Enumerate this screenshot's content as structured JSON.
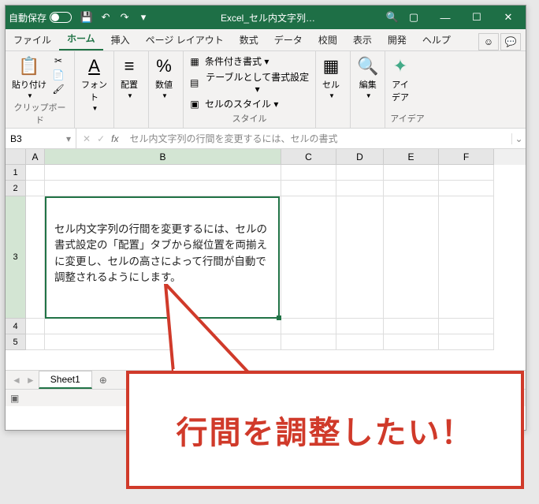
{
  "titlebar": {
    "autosave": "自動保存",
    "filename": "Excel_セル内文字列…"
  },
  "tabs": {
    "file": "ファイル",
    "home": "ホーム",
    "insert": "挿入",
    "layout": "ページ レイアウト",
    "formulas": "数式",
    "data": "データ",
    "review": "校閲",
    "view": "表示",
    "developer": "開発",
    "help": "ヘルプ"
  },
  "ribbon": {
    "clipboard": {
      "label": "クリップボード",
      "paste": "貼り付け"
    },
    "font": {
      "label": "フォント"
    },
    "align": {
      "label": "配置"
    },
    "number": {
      "label": "数値"
    },
    "styles": {
      "label": "スタイル",
      "cond": "条件付き書式 ▾",
      "table": "テーブルとして書式設定 ▾",
      "cell": "セルのスタイル ▾"
    },
    "cells": {
      "label": "セル"
    },
    "editing": {
      "label": "編集"
    },
    "ideas": {
      "label": "アイデア",
      "btn": "アイ\nデア"
    }
  },
  "namebox": "B3",
  "formula": "セル内文字列の行間を変更するには、セルの書式",
  "cols": {
    "A": "A",
    "B": "B",
    "C": "C",
    "D": "D",
    "E": "E",
    "F": "F"
  },
  "colw": {
    "A": 24,
    "B": 300,
    "C": 70,
    "D": 60,
    "E": 70,
    "F": 70
  },
  "rows": [
    "1",
    "2",
    "3",
    "4",
    "5"
  ],
  "cell_text": "セル内文字列の行間を変更するには、セルの書式設定の「配置」タブから縦位置を両揃えに変更し、セルの高さによって行間が自動で調整されるようにします。",
  "sheet_tab": "Sheet1",
  "callout": "行間を調整したい！"
}
